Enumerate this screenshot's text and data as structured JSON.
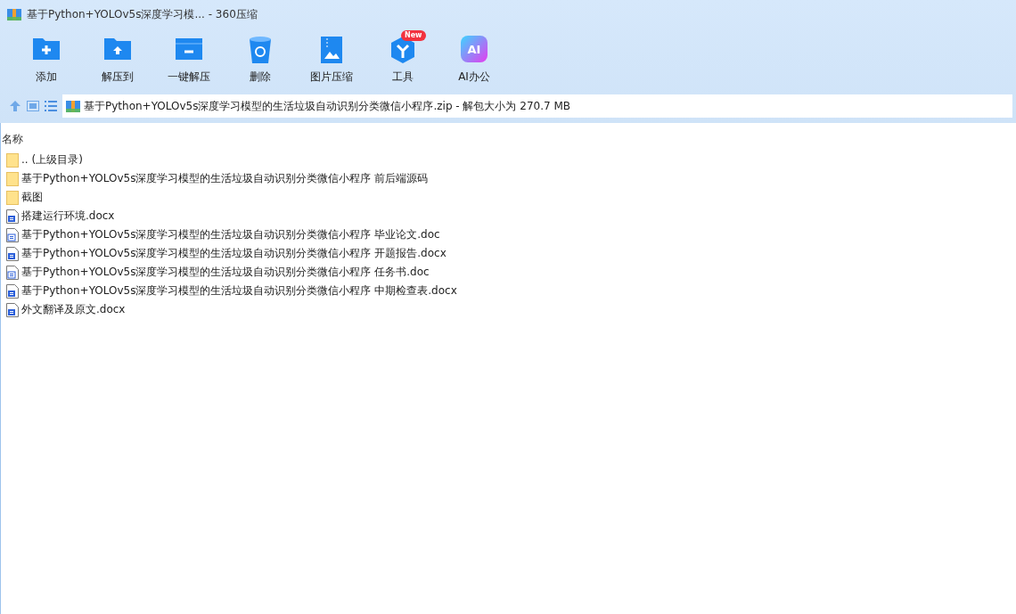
{
  "window": {
    "title": "基于Python+YOLOv5s深度学习模... - 360压缩"
  },
  "toolbar": [
    {
      "kind": "add",
      "label": "添加"
    },
    {
      "kind": "extract",
      "label": "解压到"
    },
    {
      "kind": "oneclick",
      "label": "一键解压"
    },
    {
      "kind": "delete",
      "label": "删除"
    },
    {
      "kind": "image",
      "label": "图片压缩"
    },
    {
      "kind": "tools",
      "label": "工具",
      "badge": "New"
    },
    {
      "kind": "ai",
      "label": "AI办公",
      "glyph": "AI"
    }
  ],
  "address": {
    "path": "基于Python+YOLOv5s深度学习模型的生活垃圾自动识别分类微信小程序.zip - 解包大小为 270.7 MB"
  },
  "table": {
    "columns": [
      "名称"
    ],
    "rows": [
      {
        "kind": "folder",
        "name": ".. (上级目录)"
      },
      {
        "kind": "folder",
        "name": "基于Python+YOLOv5s深度学习模型的生活垃圾自动识别分类微信小程序 前后端源码"
      },
      {
        "kind": "folder",
        "name": "截图"
      },
      {
        "kind": "docx",
        "name": "搭建运行环境.docx"
      },
      {
        "kind": "doc",
        "name": "基于Python+YOLOv5s深度学习模型的生活垃圾自动识别分类微信小程序 毕业论文.doc"
      },
      {
        "kind": "docx",
        "name": "基于Python+YOLOv5s深度学习模型的生活垃圾自动识别分类微信小程序 开题报告.docx"
      },
      {
        "kind": "doc",
        "name": "基于Python+YOLOv5s深度学习模型的生活垃圾自动识别分类微信小程序 任务书.doc"
      },
      {
        "kind": "docx",
        "name": "基于Python+YOLOv5s深度学习模型的生活垃圾自动识别分类微信小程序 中期检查表.docx"
      },
      {
        "kind": "docx",
        "name": "外文翻译及原文.docx"
      }
    ]
  }
}
